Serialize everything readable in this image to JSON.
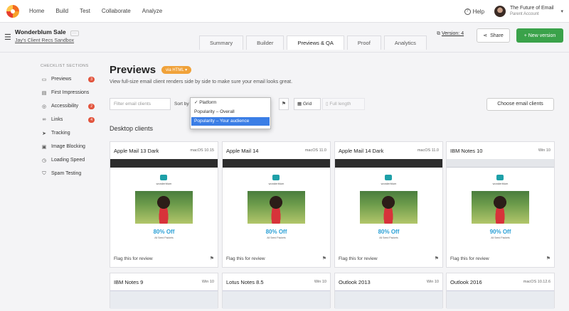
{
  "nav": {
    "links": [
      "Home",
      "Build",
      "Test",
      "Collaborate",
      "Analyze"
    ],
    "help": "Help",
    "account_name": "The Future of Email",
    "account_role": "Parent Account"
  },
  "header": {
    "campaign": "Wonderblum Sale",
    "campaign_tag": "···",
    "sandbox": "Jay's Client Recs Sandbox",
    "tabs": [
      "Summary",
      "Builder",
      "Previews & QA",
      "Proof",
      "Analytics"
    ],
    "version_label": "Version: 4",
    "share": "Share",
    "new_version": "+ New version"
  },
  "sidebar": {
    "heading": "CHECKLIST SECTIONS",
    "items": [
      {
        "label": "Previews",
        "icon": "monitor-icon",
        "badge": "3"
      },
      {
        "label": "First Impressions",
        "icon": "inbox-icon",
        "badge": ""
      },
      {
        "label": "Accessibility",
        "icon": "person-icon",
        "badge": "2"
      },
      {
        "label": "Links",
        "icon": "link-icon",
        "badge": "4"
      },
      {
        "label": "Tracking",
        "icon": "send-icon",
        "badge": ""
      },
      {
        "label": "Image Blocking",
        "icon": "image-icon",
        "badge": ""
      },
      {
        "label": "Loading Speed",
        "icon": "speed-icon",
        "badge": ""
      },
      {
        "label": "Spam Testing",
        "icon": "shield-icon",
        "badge": ""
      }
    ]
  },
  "main": {
    "title": "Previews",
    "via": "via HTML",
    "description": "View full-size email client renders side by side to make sure your email looks great.",
    "filter_placeholder": "Filter email clients",
    "sort_label": "Sort by",
    "sort_options": [
      "✓ Platform",
      "Popularity – Overall",
      "Popularity – Your audience"
    ],
    "grid": "Grid",
    "full_length": "Full length",
    "choose_clients": "Choose email clients",
    "section_title": "Desktop clients",
    "flag_label": "Flag this for review",
    "email_brand": "wonderblum",
    "offer": "80% Off",
    "offer_alt": "90% Off",
    "offer_sub": "All Seed Packets"
  },
  "clients": [
    {
      "name": "Apple Mail 13 Dark",
      "os": "macOS 10.15",
      "dark": true,
      "offer": "80% Off"
    },
    {
      "name": "Apple Mail 14",
      "os": "macOS 11.0",
      "dark": true,
      "offer": "80% Off"
    },
    {
      "name": "Apple Mail 14 Dark",
      "os": "macOS 11.0",
      "dark": true,
      "offer": "80% Off"
    },
    {
      "name": "IBM Notes 10",
      "os": "Win 10",
      "dark": false,
      "offer": "90% Off"
    },
    {
      "name": "IBM Notes 9",
      "os": "Win 10"
    },
    {
      "name": "Lotus Notes 8.5",
      "os": "Win 10"
    },
    {
      "name": "Outlook 2013",
      "os": "Win 10"
    },
    {
      "name": "Outlook 2016",
      "os": "macOS 10.12.6"
    }
  ],
  "colors": {
    "accent_green": "#3aa24a",
    "badge_red": "#e2543d",
    "via_orange": "#f0a23a",
    "selection_blue": "#3b7ee6",
    "offer_blue": "#2ba0d6"
  }
}
